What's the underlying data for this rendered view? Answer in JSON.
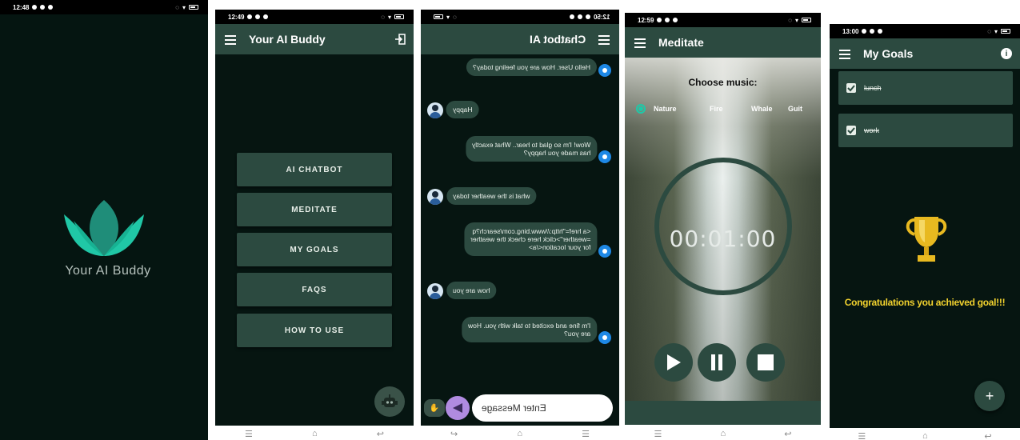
{
  "splash": {
    "time": "12:48",
    "app_name": "Your AI Buddy",
    "icons": [
      "signal-icon",
      "alarm-icon",
      "whatsapp-icon",
      "instagram-icon",
      "mute-icon",
      "wifi-icon",
      "battery-icon"
    ]
  },
  "home": {
    "time": "12:49",
    "title": "Your AI Buddy",
    "menu": [
      "AI CHATBOT",
      "MEDITATE",
      "MY GOALS",
      "FAQS",
      "HOW TO USE"
    ]
  },
  "chat": {
    "time": "12:50",
    "title": "Chatbot AI",
    "messages": [
      {
        "from": "bot",
        "lines": [
          "Hello User. How are you feeling today?"
        ]
      },
      {
        "from": "user",
        "lines": [
          "Happy"
        ]
      },
      {
        "from": "bot",
        "lines": [
          "Wow! I'm so glad to hear.. What exactly",
          "has made you happy?"
        ]
      },
      {
        "from": "user",
        "lines": [
          "what is the weather today"
        ]
      },
      {
        "from": "bot",
        "lines": [
          "<a href=\"http://www.bing.com/search?q",
          "=weather\">click here check the weather",
          "for your location</a>"
        ]
      },
      {
        "from": "user",
        "lines": [
          "how are you"
        ]
      },
      {
        "from": "bot",
        "lines": [
          "I'm fine and excited to talk with you. How",
          "are you?"
        ]
      }
    ],
    "input_placeholder": "Enter Message"
  },
  "meditate": {
    "time": "12:59",
    "title": "Meditate",
    "choose_label": "Choose music:",
    "options": [
      "Nature",
      "Fire",
      "Whale",
      "Guit"
    ],
    "selected_option": "Nature",
    "counter": "1",
    "timer": "00:01:00"
  },
  "goals": {
    "time": "13:00",
    "title": "My Goals",
    "items": [
      {
        "text": "lunch",
        "done": true
      },
      {
        "text": "work",
        "done": true
      }
    ],
    "congrats": "Congratulations you achieved goal!!!",
    "fab_label": "+"
  },
  "colors": {
    "dark_bg": "#061511",
    "primary": "#2c4a40",
    "accent_teal": "#1ec9a8",
    "gold": "#f2d22e",
    "send_purple": "#b08be0"
  }
}
